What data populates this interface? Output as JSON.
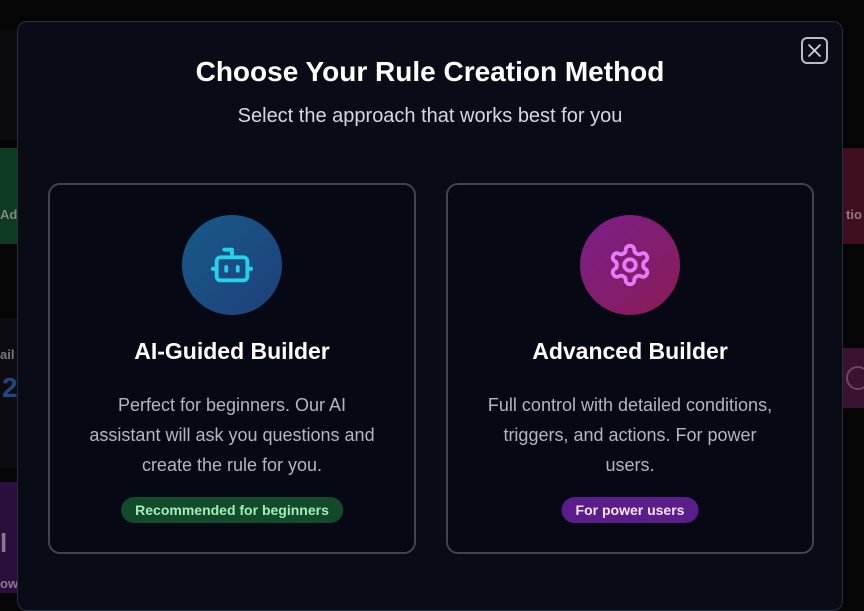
{
  "background": {
    "left_label_1": "Ad",
    "left_label_2": "ail",
    "left_number": "2",
    "left_label_3": "l",
    "left_label_4": "ow",
    "right_label_1": "tio"
  },
  "modal": {
    "title": "Choose Your Rule Creation Method",
    "subtitle": "Select the approach that works best for you",
    "close_icon": "close-icon"
  },
  "cards": [
    {
      "id": "ai-guided",
      "icon": "robot-icon",
      "title": "AI-Guided Builder",
      "description": "Perfect for beginners. Our AI assistant will ask you questions and create the rule for you.",
      "badge": "Recommended for beginners",
      "badge_color": "#134a2b",
      "accent": "#22d3ee"
    },
    {
      "id": "advanced",
      "icon": "gear-icon",
      "title": "Advanced Builder",
      "description": "Full control with detailed conditions, triggers, and actions. For power users.",
      "badge": "For power users",
      "badge_color": "#5a1d8a",
      "accent": "#e879f9"
    }
  ]
}
